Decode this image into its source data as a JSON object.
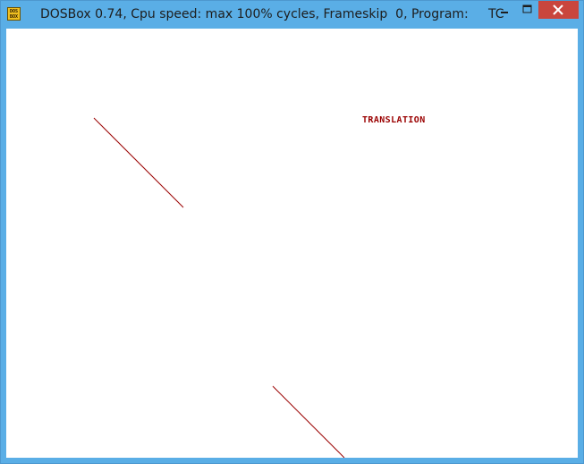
{
  "window": {
    "title": "DOSBox 0.74, Cpu speed: max 100% cycles, Frameskip  0, Program:     TC",
    "app_icon_text": "DOS BOX",
    "controls": {
      "minimize_icon": "minimize-icon",
      "maximize_icon": "maximize-icon",
      "close_icon": "close-icon"
    }
  },
  "screen": {
    "label": "TRANSLATION",
    "line_color": "#9a0000"
  }
}
